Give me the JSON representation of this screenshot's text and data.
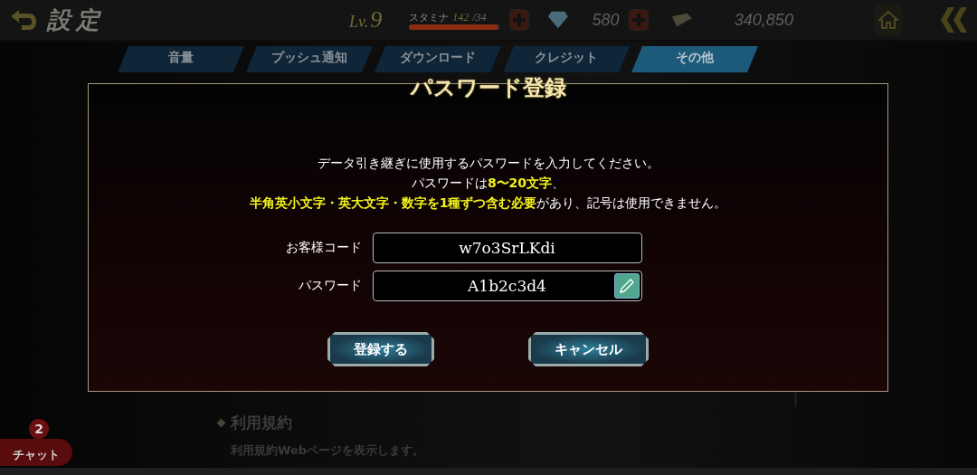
{
  "header": {
    "title": "設定",
    "level_label": "Lv.",
    "level": "9",
    "stamina": {
      "label": "スタミナ",
      "current": "142",
      "max": "/34",
      "level": 0.97
    },
    "gems": "580",
    "money": "340,850"
  },
  "tabs": [
    {
      "label": "音量",
      "selected": false
    },
    {
      "label": "プッシュ通知",
      "selected": false
    },
    {
      "label": "ダウンロード",
      "selected": false
    },
    {
      "label": "クレジット",
      "selected": false
    },
    {
      "label": "その他",
      "selected": true
    }
  ],
  "background_sections": [
    {
      "title": "利用規約",
      "description": "利用規約Webページを表示します。"
    }
  ],
  "dialog": {
    "title": "パスワード登録",
    "message": [
      "データ引き継ぎに使用するパスワードを入力してください。",
      "パスワードは**8〜20文字**、",
      "**半角英小文字・英大文字・数字を1種ずつ含む必要**があり、記号は使用できません。"
    ],
    "fields": [
      {
        "label": "お客様コード",
        "value": "w7o3SrLKdi",
        "editable": false
      },
      {
        "label": "パスワード",
        "value": "A1b2c3d4",
        "editable": true
      }
    ],
    "buttons": [
      "登録する",
      "キャンセル"
    ]
  },
  "chat": {
    "label": "チャット",
    "badge": "2"
  }
}
